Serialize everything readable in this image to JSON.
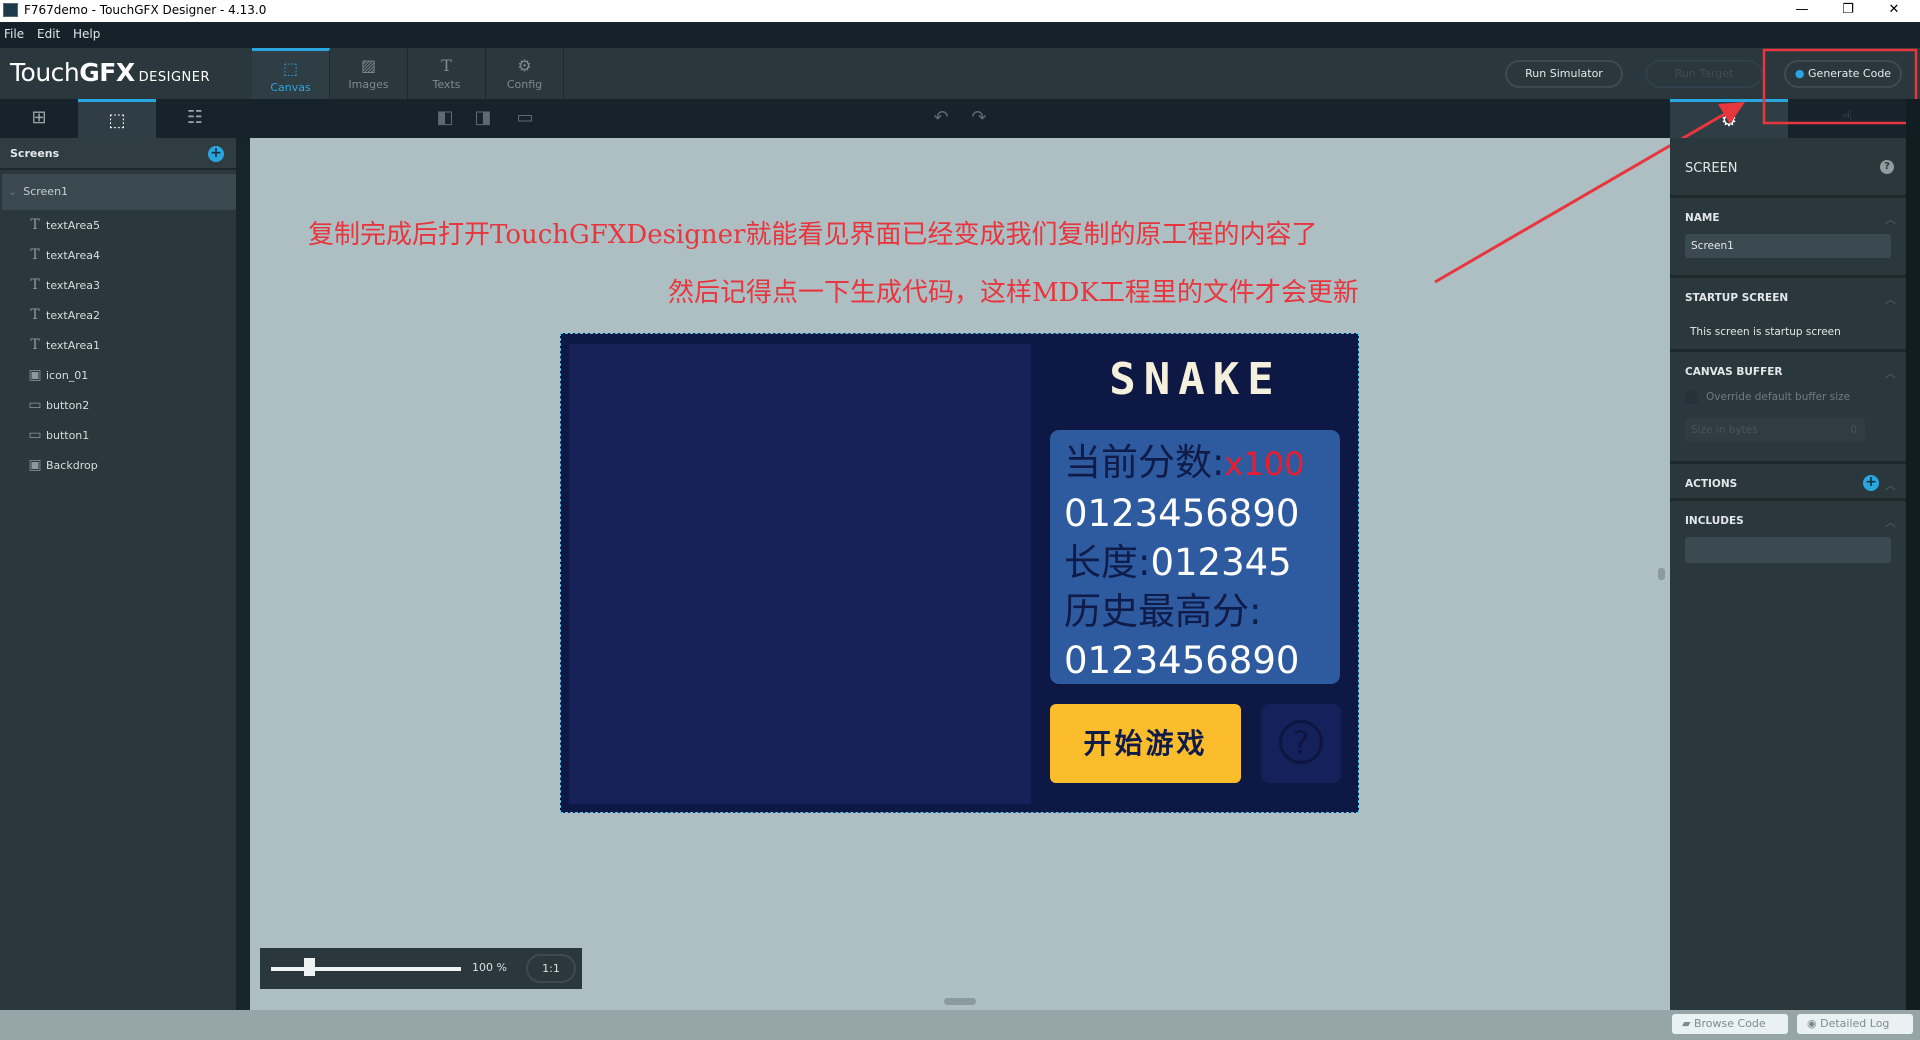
{
  "window": {
    "title": "F767demo - TouchGFX Designer - 4.13.0",
    "controls": [
      "—",
      "❐",
      "✕"
    ]
  },
  "menu": [
    "File",
    "Edit",
    "Help"
  ],
  "brand": {
    "main": "Touch",
    "bold": "GFX",
    "suffix": "DESIGNER"
  },
  "tabs": [
    {
      "label": "Canvas",
      "icon": "⬚"
    },
    {
      "label": "Images",
      "icon": "▨"
    },
    {
      "label": "Texts",
      "icon": "T"
    },
    {
      "label": "Config",
      "icon": "⚙"
    }
  ],
  "actions": {
    "run_simulator": "Run Simulator",
    "run_target": "Run Target",
    "generate_code": "Generate Code"
  },
  "colors": {
    "accent": "#29a5df",
    "annotation": "#e8363f",
    "highlight_box": "#e8363f"
  },
  "left": {
    "header": "Screens",
    "screen": "Screen1",
    "items": [
      {
        "label": "textArea5",
        "icon": "T"
      },
      {
        "label": "textArea4",
        "icon": "T"
      },
      {
        "label": "textArea3",
        "icon": "T"
      },
      {
        "label": "textArea2",
        "icon": "T"
      },
      {
        "label": "textArea1",
        "icon": "T"
      },
      {
        "label": "icon_01",
        "icon": "▣"
      },
      {
        "label": "button2",
        "icon": "▭"
      },
      {
        "label": "button1",
        "icon": "▭"
      },
      {
        "label": "Backdrop",
        "icon": "▣"
      }
    ]
  },
  "annotations": {
    "line1": "复制完成后打开TouchGFXDesigner就能看见界面已经变成我们复制的原工程的内容了",
    "line2": "然后记得点一下生成代码，这样MDK工程里的文件才会更新"
  },
  "device": {
    "title": "SNAKE",
    "score_label": "当前分数:",
    "score_multiplier": "x100",
    "score_value": "0123456890",
    "length_label": "长度:",
    "length_value": "012345",
    "high_label": "历史最高分:",
    "high_value": "0123456890",
    "start_button": "开始游戏",
    "help_icon": "?"
  },
  "zoom": {
    "value": "100 %",
    "level_percent": 100,
    "reset": "1:1"
  },
  "properties": {
    "title": "SCREEN",
    "name_label": "NAME",
    "name_value": "Screen1",
    "startup_label": "STARTUP SCREEN",
    "startup_text": "This screen is startup screen",
    "buffer_label": "CANVAS BUFFER",
    "buffer_checkbox": "Override default buffer size",
    "buffer_checked": false,
    "size_placeholder": "Size in bytes",
    "size_value": "0",
    "actions_label": "ACTIONS",
    "includes_label": "INCLUDES"
  },
  "status": {
    "browse_code": "Browse Code",
    "detailed_log": "Detailed Log"
  }
}
